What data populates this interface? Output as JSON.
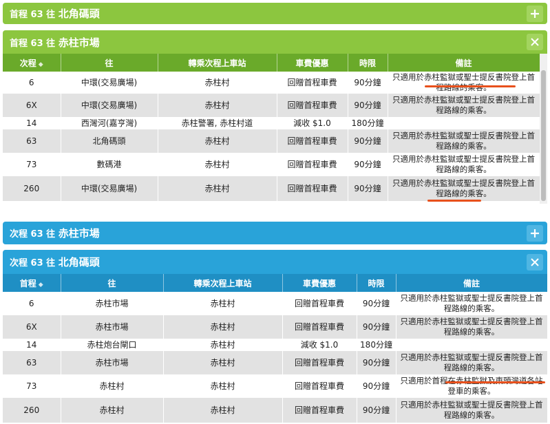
{
  "panel1": {
    "header_prefix": "首程 63 往",
    "header_dest": "北角碼頭",
    "button": "+"
  },
  "panel2": {
    "header_prefix": "首程 63 往",
    "header_dest": "赤柱市場",
    "button": "✕",
    "columns": [
      "次程",
      "往",
      "轉乘次程上車站",
      "車費優惠",
      "時限",
      "備註"
    ],
    "rows": [
      [
        "6",
        "中環(交易廣場)",
        "赤柱村",
        "回贈首程車費",
        "90分鐘",
        "只適用於赤柱監獄或聖士提反書院登上首程路線的乘客。"
      ],
      [
        "6X",
        "中環(交易廣場)",
        "赤柱村",
        "回贈首程車費",
        "90分鐘",
        "只適用於赤柱監獄或聖士提反書院登上首程路線的乘客。"
      ],
      [
        "14",
        "西灣河(嘉亨灣)",
        "赤柱警署, 赤柱村道",
        "減收 $1.0",
        "180分鐘",
        ""
      ],
      [
        "63",
        "北角碼頭",
        "赤柱村",
        "回贈首程車費",
        "90分鐘",
        "只適用於赤柱監獄或聖士提反書院登上首程路線的乘客。"
      ],
      [
        "73",
        "數碼港",
        "赤柱村",
        "回贈首程車費",
        "90分鐘",
        "只適用於赤柱監獄或聖士提反書院登上首程路線的乘客。"
      ],
      [
        "260",
        "中環(交易廣場)",
        "赤柱村",
        "回贈首程車費",
        "90分鐘",
        "只適用於赤柱監獄或聖士提反書院登上首程路線的乘客。"
      ]
    ]
  },
  "panel3": {
    "header_prefix": "次程 63 往",
    "header_dest": "赤柱市場",
    "button": "+"
  },
  "panel4": {
    "header_prefix": "次程 63 往",
    "header_dest": "北角碼頭",
    "button": "✕",
    "columns": [
      "首程",
      "往",
      "轉乘次程上車站",
      "車費優惠",
      "時限",
      "備註"
    ],
    "rows": [
      [
        "6",
        "赤柱市場",
        "赤柱村",
        "回贈首程車費",
        "90分鐘",
        "只適用於赤柱監獄或聖士提反書院登上首程路線的乘客。"
      ],
      [
        "6X",
        "赤柱市場",
        "赤柱村",
        "回贈首程車費",
        "90分鐘",
        "只適用於赤柱監獄或聖士提反書院登上首程路線的乘客。"
      ],
      [
        "14",
        "赤柱炮台閘口",
        "赤柱村",
        "減收 $1.0",
        "180分鐘",
        ""
      ],
      [
        "63",
        "赤柱市場",
        "赤柱村",
        "回贈首程車費",
        "90分鐘",
        "只適用於赤柱監獄或聖士提反書院登上首程路線的乘客。"
      ],
      [
        "73",
        "赤柱村",
        "赤柱村",
        "回贈首程車費",
        "90分鐘",
        "只適用於首程在赤柱監獄及東頭灣道各站登車的乘客。"
      ],
      [
        "260",
        "赤柱村",
        "赤柱村",
        "回贈首程車費",
        "90分鐘",
        "只適用於赤柱監獄或聖士提反書院登上首程路線的乘客。"
      ]
    ]
  },
  "colors": {
    "green": "#8cc63f",
    "green_dark": "#6aaa2a",
    "blue": "#29a3d9",
    "blue_dark": "#1f8fc4",
    "underline": "#e8501c"
  }
}
